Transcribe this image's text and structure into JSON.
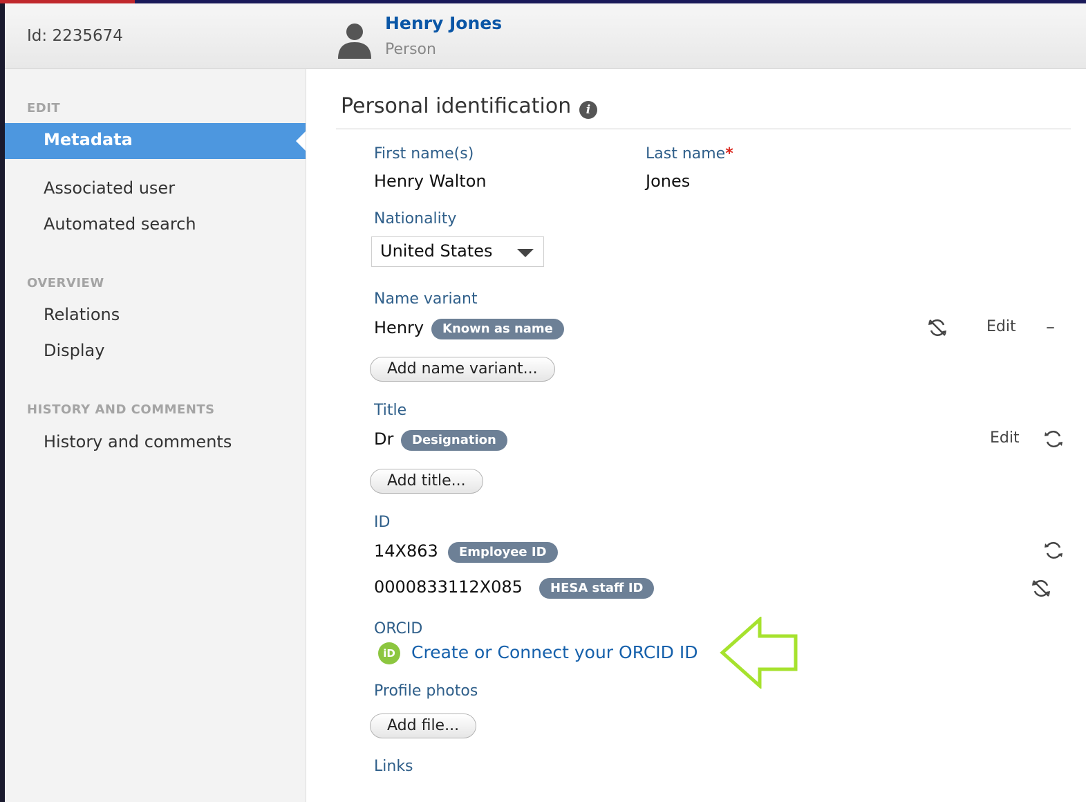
{
  "header": {
    "id_text": "Id: 2235674",
    "person_name": "Henry Jones",
    "person_type": "Person"
  },
  "sidebar": {
    "sections": [
      {
        "title": "EDIT",
        "items": [
          "Metadata",
          "Associated user",
          "Automated search"
        ]
      },
      {
        "title": "OVERVIEW",
        "items": [
          "Relations",
          "Display"
        ]
      },
      {
        "title": "HISTORY AND COMMENTS",
        "items": [
          "History and comments"
        ]
      }
    ],
    "active_item": "Metadata"
  },
  "main": {
    "section_title": "Personal identification",
    "first_name_label": "First name(s)",
    "first_name_value": "Henry Walton",
    "last_name_label": "Last name",
    "last_name_required": "*",
    "last_name_value": "Jones",
    "nationality_label": "Nationality",
    "nationality_value": "United States",
    "name_variant_label": "Name variant",
    "name_variant_value": "Henry",
    "name_variant_badge": "Known as name",
    "name_variant_edit": "Edit",
    "name_variant_remove": "–",
    "add_name_variant": "Add name variant...",
    "title_label": "Title",
    "title_value": "Dr",
    "title_badge": "Designation",
    "title_edit": "Edit",
    "add_title": "Add title...",
    "id_label": "ID",
    "ids": [
      {
        "value": "14X863",
        "badge": "Employee ID",
        "icon": "sync-icon"
      },
      {
        "value": "0000833112X085",
        "badge": "HESA staff ID",
        "icon": "sync-disabled-icon"
      }
    ],
    "orcid_label": "ORCID",
    "orcid_icon_text": "iD",
    "orcid_link": "Create or Connect your ORCID ID",
    "profile_photos_label": "Profile photos",
    "add_file": "Add file...",
    "links_label": "Links"
  },
  "colors": {
    "accent": "#4d97df",
    "badge": "#6d8096",
    "link": "#1560ab",
    "label": "#2f5f8a",
    "orcid": "#8cc63f",
    "arrow": "#a6e22e"
  }
}
